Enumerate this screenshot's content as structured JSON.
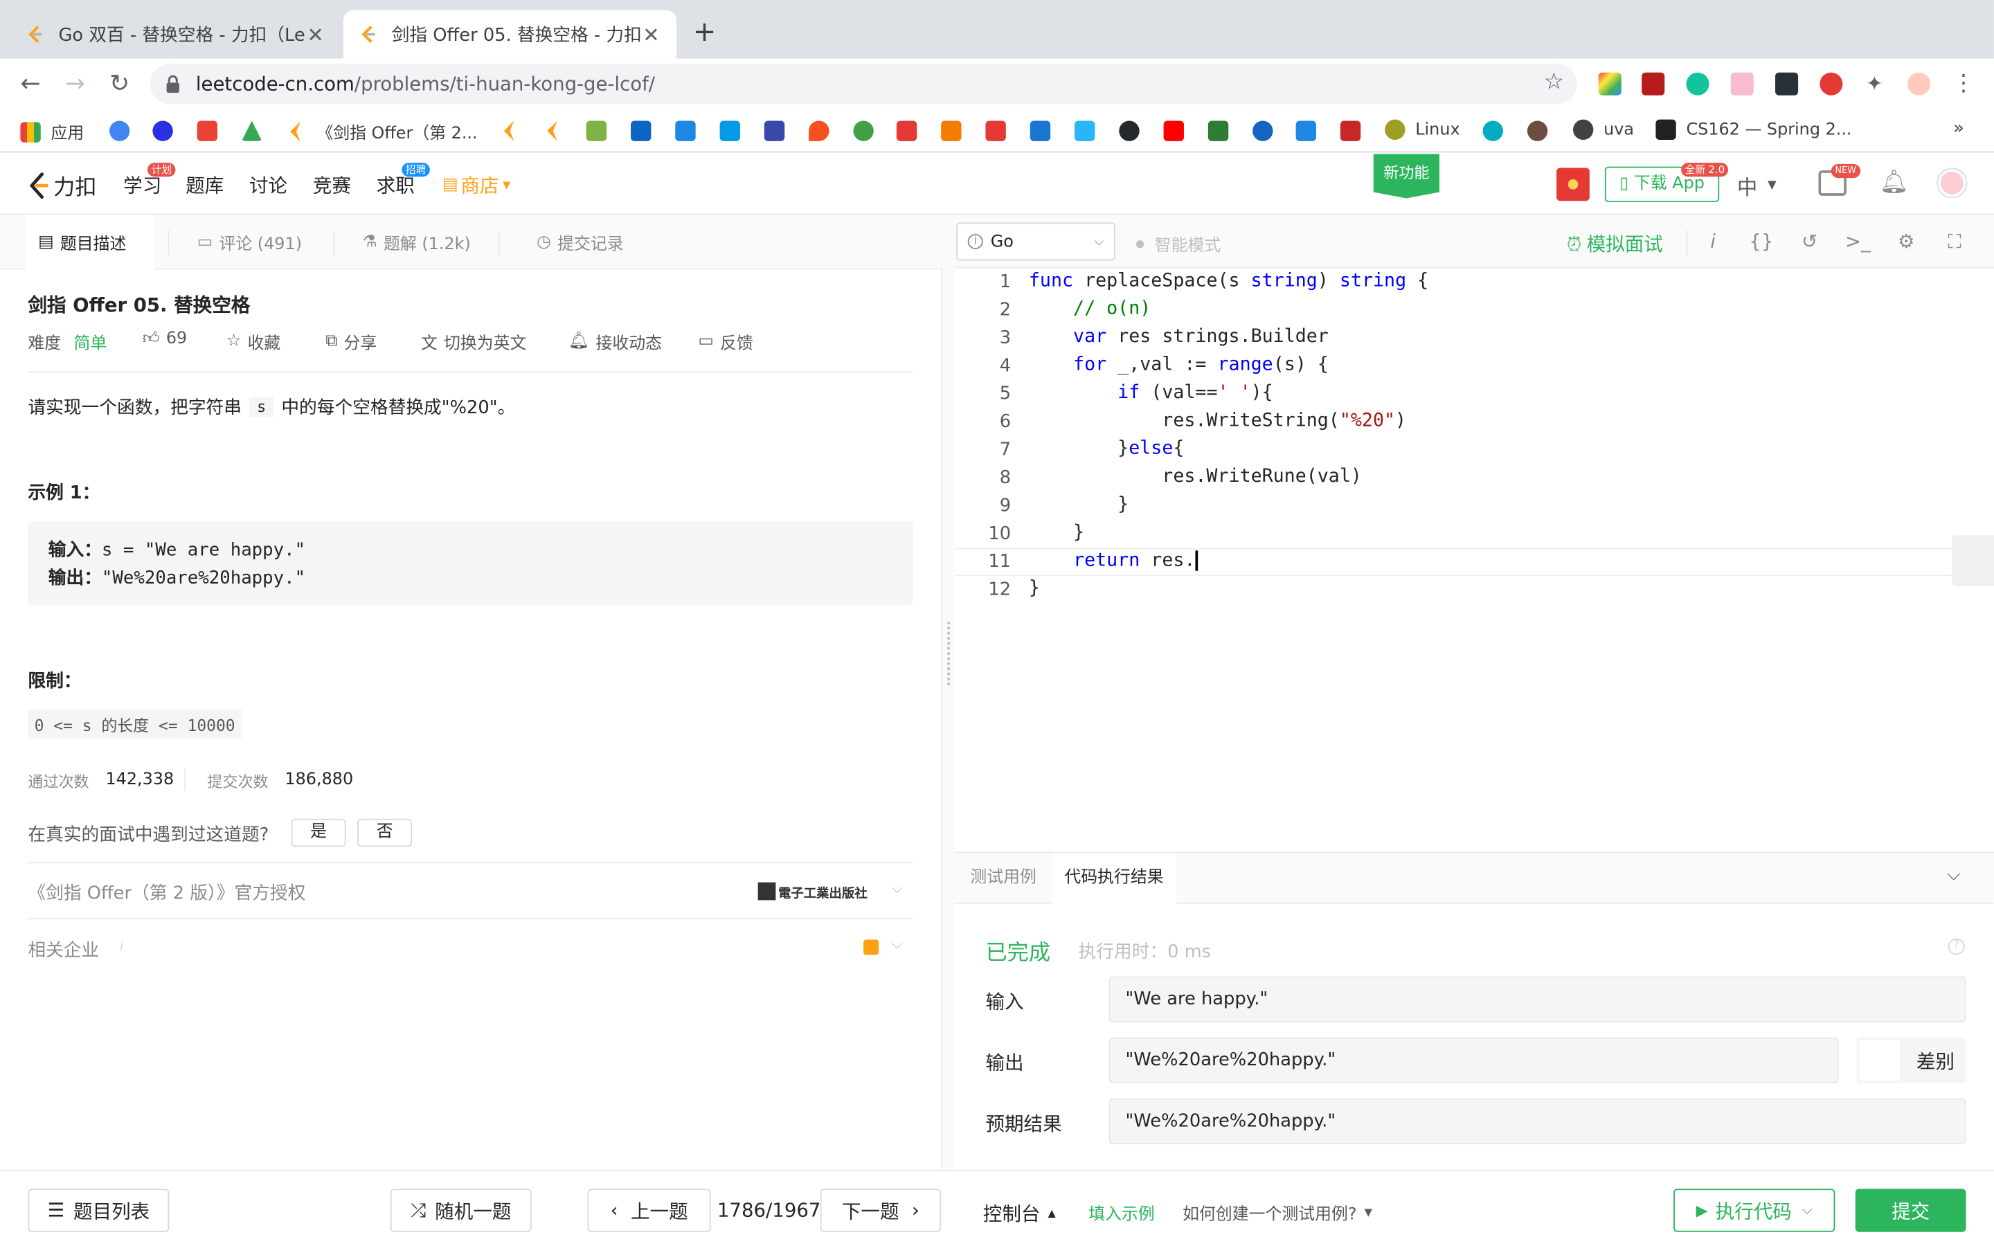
{
  "browser": {
    "tabs": [
      {
        "title": "Go 双百 - 替换空格 - 力扣（Lee"
      },
      {
        "title": "剑指 Offer 05. 替换空格 - 力扣"
      }
    ],
    "url_host": "leetcode-cn.com",
    "url_path": "/problems/ti-huan-kong-ge-lcof/",
    "bookmarks": [
      "应用",
      "《剑指 Offer（第 2...",
      "Linux",
      "uva",
      "CS162 — Spring 2..."
    ]
  },
  "site": {
    "logo": "力扣",
    "nav": [
      "学习",
      "题库",
      "讨论",
      "竞赛",
      "求职",
      "商店"
    ],
    "badge_study": "计划",
    "badge_job": "招聘",
    "new_feature": "新功能",
    "download": "下载 App",
    "download_badge": "全新 2.0",
    "lang": "中",
    "new_badge": "NEW"
  },
  "left": {
    "tabs": [
      "题目描述",
      "评论 (491)",
      "题解 (1.2k)",
      "提交记录"
    ],
    "title": "剑指 Offer 05. 替换空格",
    "difficulty_label": "难度",
    "difficulty": "简单",
    "likes": "69",
    "actions": [
      "收藏",
      "分享",
      "切换为英文",
      "接收动态",
      "反馈"
    ],
    "desc_pre": "请实现一个函数，把字符串",
    "desc_code": "s",
    "desc_post": "中的每个空格替换成\"%20\"。",
    "example_title": "示例 1：",
    "ex_input_label": "输入",
    "ex_input": "s = \"We are happy.\"",
    "ex_output_label": "输出",
    "ex_output": "\"We%20are%20happy.\"",
    "limit_title": "限制：",
    "limit": "0 <= s 的长度 <= 10000",
    "accepted_label": "通过次数",
    "accepted": "142,338",
    "submit_label": "提交次数",
    "submissions": "186,880",
    "interview_q": "在真实的面试中遇到过这道题?",
    "yes": "是",
    "no": "否",
    "book_auth": "《剑指 Offer（第 2 版）》官方授权",
    "publisher": "電子工業出版社",
    "companies": "相关企业",
    "companies_info": "i"
  },
  "editor": {
    "language": "Go",
    "smart_mode": "智能模式",
    "mock_interview": "模拟面试",
    "lines": [
      "func replaceSpace(s string) string {",
      "    // o(n)",
      "    var res strings.Builder",
      "    for _,val := range(s) {",
      "        if (val==' '){",
      "            res.WriteString(\"%20\")",
      "        }else{",
      "            res.WriteRune(val)",
      "        }",
      "    }",
      "    return res.",
      "}"
    ]
  },
  "results": {
    "tabs": [
      "测试用例",
      "代码执行结果"
    ],
    "status": "已完成",
    "runtime": "执行用时：0 ms",
    "input_label": "输入",
    "input": "\"We are happy.\"",
    "output_label": "输出",
    "output": "\"We%20are%20happy.\"",
    "diff": "差别",
    "expected_label": "预期结果",
    "expected": "\"We%20are%20happy.\""
  },
  "bottom": {
    "problem_list": "题目列表",
    "random": "随机一题",
    "prev": "上一题",
    "page": "1786/1967",
    "next": "下一题",
    "console": "控制台",
    "fill_example": "填入示例",
    "how_create": "如何创建一个测试用例?",
    "run": "执行代码",
    "submit": "提交"
  },
  "colors": {
    "accent": "#2db55d",
    "link": "#1a90ff",
    "keyword": "#0000ff",
    "comment": "#008000",
    "string": "#a31515"
  }
}
